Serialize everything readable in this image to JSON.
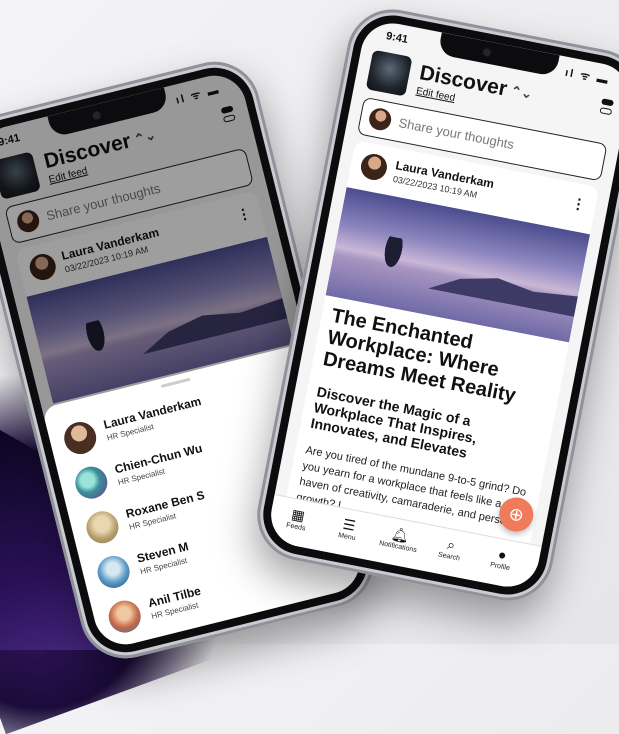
{
  "status": {
    "time": "9:41",
    "icons": "ıl ᯤ ▬"
  },
  "header": {
    "title": "Discover",
    "chevron": "⌃⌄",
    "edit_feed": "Edit feed"
  },
  "share": {
    "placeholder": "Share your thoughts"
  },
  "post": {
    "author": "Laura Vanderkam",
    "date": "03/22/2023 10:19 AM",
    "more": "⋮",
    "headline": "The Enchanted Workplace: Where Dreams Meet Reality",
    "subheadline": "Discover the Magic of a Workplace That Inspires, Innovates, and Elevates",
    "body": "Are you tired of the mundane 9-to-5 grind? Do you yearn for a workplace that feels like a haven of creativity, camaraderie, and personal growth? L..."
  },
  "tabs": [
    {
      "label": "Feeds",
      "icon": "grid-icon",
      "glyph": "▦"
    },
    {
      "label": "Menu",
      "icon": "menu-icon",
      "glyph": "☰"
    },
    {
      "label": "Notifications",
      "icon": "bell-icon",
      "glyph": "🔔︎"
    },
    {
      "label": "Search",
      "icon": "search-icon",
      "glyph": "⌕"
    },
    {
      "label": "Profile",
      "icon": "avatar-icon",
      "glyph": "●"
    }
  ],
  "fab": {
    "glyph": "⊕",
    "icon": "add-icon"
  },
  "people": [
    {
      "name": "Laura Vanderkam",
      "role": "HR Specialist",
      "avatar_color": "#6b4a3a"
    },
    {
      "name": "Chien-Chun Wu",
      "role": "HR Specialist",
      "avatar_color": "#3aa6a0"
    },
    {
      "name": "Roxane Ben S",
      "role": "HR Specialist",
      "avatar_color": "#c8a86a"
    },
    {
      "name": "Steven M",
      "role": "HR Specialist",
      "avatar_color": "#4a86c8"
    },
    {
      "name": "Anil Tilbe",
      "role": "HR Specialist",
      "avatar_color": "#b5563c"
    }
  ]
}
